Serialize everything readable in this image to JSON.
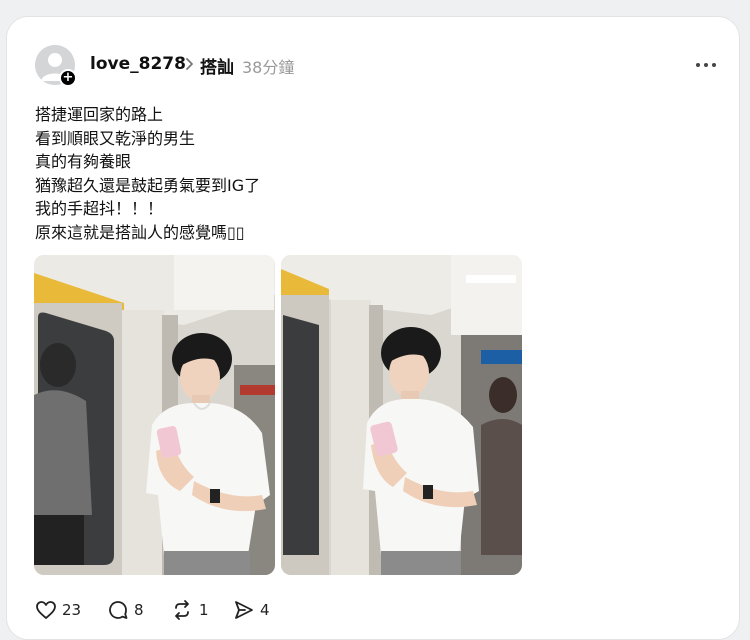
{
  "post": {
    "username": "love_8278",
    "topic": "搭訕",
    "time_ago": "38分鐘",
    "lines": [
      "搭捷運回家的路上",
      "看到順眼又乾淨的男生",
      "真的有夠養眼",
      "猶豫超久還是鼓起勇氣要到IG了",
      "我的手超抖！！！",
      "原來這就是搭訕人的感覺嗎▯▯"
    ],
    "images": [
      {
        "icon": "photo-subway-man-with-phone"
      },
      {
        "icon": "photo-subway-man-with-phone"
      }
    ]
  },
  "actions": {
    "likes": "23",
    "comments": "8",
    "reposts": "1",
    "shares": "4"
  },
  "icons": {
    "avatar": "default-user-avatar-icon",
    "follow": "plus-icon",
    "chevron": "chevron-right-icon",
    "more": "more-horizontal-icon",
    "like": "heart-icon",
    "comment": "comment-icon",
    "repost": "repost-icon",
    "share": "send-icon"
  }
}
